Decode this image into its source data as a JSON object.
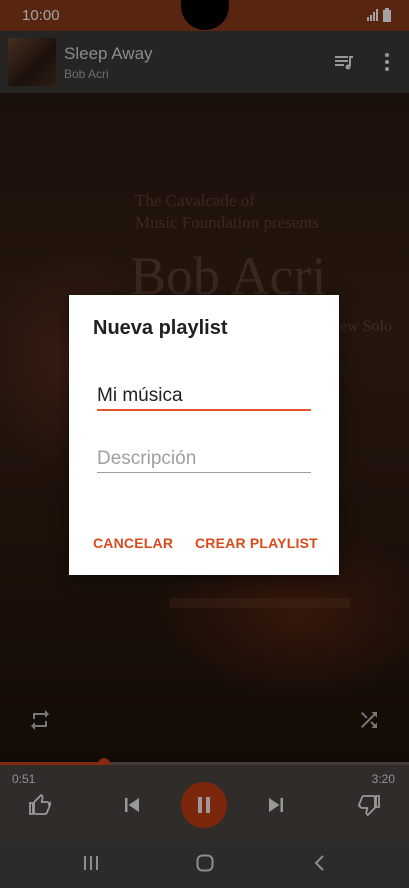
{
  "status_bar": {
    "time": "10:00",
    "icons": [
      "signal-icon",
      "battery-icon"
    ]
  },
  "now_playing": {
    "title": "Sleep Away",
    "artist": "Bob Acri",
    "icons": [
      "queue-icon",
      "more-vert-icon"
    ]
  },
  "album_art": {
    "line1": "The Cavalcade of",
    "line2": "Music Foundation presents",
    "big_text": "Bob Acri",
    "extra_text": "ew Solo"
  },
  "dialog": {
    "title": "Nueva playlist",
    "name_value": "Mi música",
    "description_placeholder": "Descripción",
    "cancel_label": "CANCELAR",
    "create_label": "CREAR PLAYLIST"
  },
  "player": {
    "time_elapsed": "0:51",
    "time_total": "3:20",
    "progress_fraction": 0.255,
    "icons": [
      "repeat-icon",
      "shuffle-icon",
      "thumbs-up-icon",
      "skip-previous-icon",
      "pause-icon",
      "skip-next-icon",
      "thumbs-down-icon"
    ]
  },
  "nav_bar": {
    "icons": [
      "recent-apps-icon",
      "home-icon",
      "back-icon"
    ]
  },
  "colors": {
    "accent": "#d84a1b",
    "status_bar": "#8a3a1c",
    "field_underline": "#e0562d"
  }
}
